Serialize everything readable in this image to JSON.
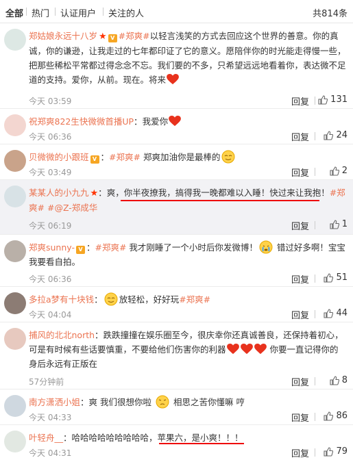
{
  "tabs": [
    "全部",
    "热门",
    "认证用户",
    "关注的人"
  ],
  "total_count": "共814条",
  "reply_label": "回复",
  "comments": [
    {
      "user": "郑姑娘永远十八岁",
      "topic": "#郑爽#",
      "body": "以轻言浅笑的方式去回应这个世界的善意。你的真诚，你的谦逊，让我走过的七年都印证了它的意义。愿陪伴你的时光能走得慢一些，把那些稀松平常都过得念念不忘。我们要的不多，只希望远远地看着你，表达微不足道的支持。爱你，从前。现在。将来",
      "time": "今天 03:59",
      "likes": "131"
    },
    {
      "user": "祝郑爽822生快微微首播UP",
      "body": "我爱你",
      "time": "今天 06:36",
      "likes": "24"
    },
    {
      "user": "贝微微的小跟班",
      "topic": "#郑爽#",
      "body": "郑爽加油你是最棒的",
      "time": "今天 03:49",
      "likes": "2"
    },
    {
      "user": "某某人的小九九",
      "body": "爽，你半夜撩我，搞得我一晚都难以入睡！快过来让我抱！",
      "topic": "#郑爽#",
      "topic2": "#@Z-郑成华",
      "time": "今天 06:19",
      "likes": "1"
    },
    {
      "user": "郑爽sunny-",
      "topic": "#郑爽#",
      "body": "我才刚睡了一个小时后你发微博！",
      "body2": "错过好多啊！宝宝我要看自拍。",
      "time": "今天 06:36",
      "likes": "51"
    },
    {
      "user": "多拉a梦有十块钱",
      "body": "放轻松，好好玩",
      "topic": "#郑爽#",
      "time": "今天 04:04",
      "likes": "44"
    },
    {
      "user": "捕风的北北north",
      "body": "跌跌撞撞在娱乐圈至今，很庆幸你还真诚善良，还保持着初心，可是有时候有些话要慎重，不要给他们伤害你的利器",
      "body2": "你要一直记得你的身后永远有正版在",
      "time": "57分钟前",
      "likes": "8"
    },
    {
      "user": "南方潇洒小姐",
      "body": "爽 我们很想你啦",
      "body2": "相思之苦你懂嘛 哼",
      "time": "今天 04:33",
      "likes": "86"
    },
    {
      "user": "叶轻舟__",
      "body": "哈哈哈哈哈哈哈哈哈，",
      "body2": "苹果六，是小爽！！！",
      "time": "今天 04:31",
      "likes": "79"
    }
  ]
}
